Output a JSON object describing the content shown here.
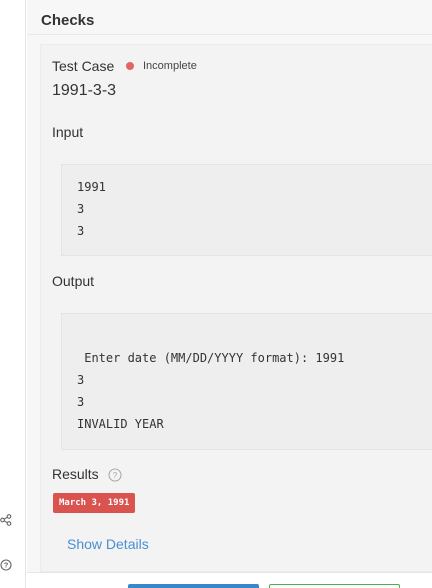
{
  "checks": {
    "title": "Checks"
  },
  "test_case": {
    "label": "Test Case",
    "status": "Incomplete",
    "status_color": "#e06666",
    "name": "1991-3-3"
  },
  "input": {
    "label": "Input",
    "lines": [
      "1991",
      "3",
      "3"
    ]
  },
  "output": {
    "label": "Output",
    "lines": [
      " Enter date (MM/DD/YYYY format): 1991",
      "3",
      "3",
      "INVALID YEAR"
    ]
  },
  "results": {
    "label": "Results",
    "badge": "March 3, 1991",
    "badge_color": "#d9534f"
  },
  "show_details": "Show Details",
  "icons": {
    "rail": [
      "share-icon",
      "help-circle-icon"
    ],
    "results_help": "help-circle-icon"
  }
}
